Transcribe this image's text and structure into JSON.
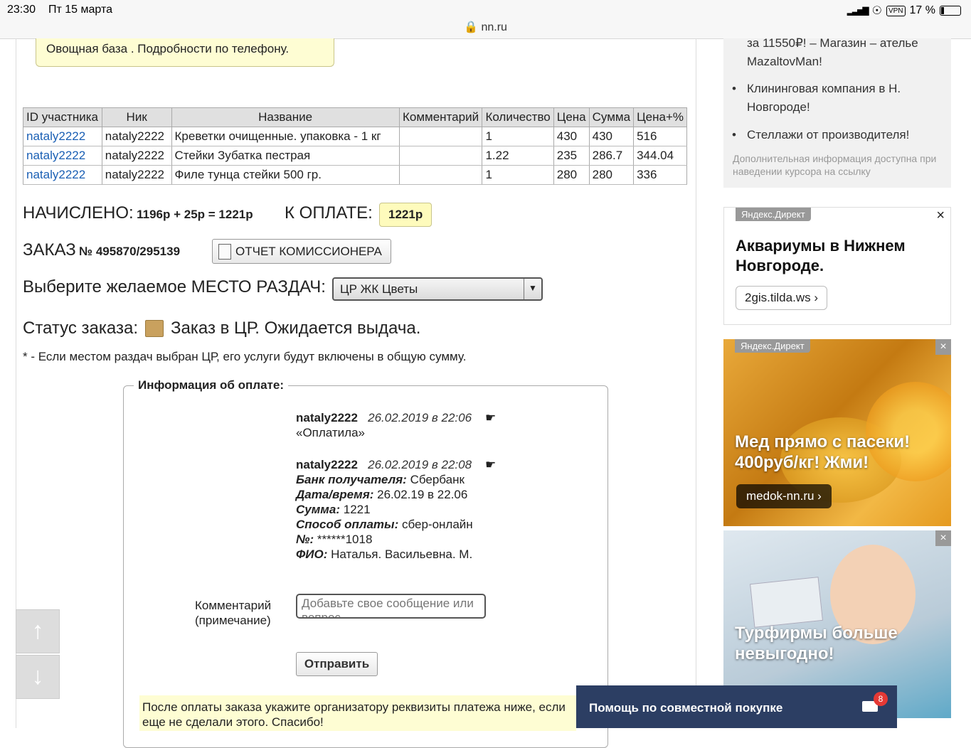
{
  "statusbar": {
    "time": "23:30",
    "date": "Пт 15 марта",
    "url": "nn.ru",
    "vpn": "VPN",
    "battery": "17 %"
  },
  "notice": {
    "text": "Овощная база . Подробности по телефону."
  },
  "orders": {
    "headers": [
      "ID участника",
      "Ник",
      "Название",
      "Комментарий",
      "Количество",
      "Цена",
      "Сумма",
      "Цена+%"
    ],
    "rows": [
      {
        "id": "nataly2222",
        "nick": "nataly2222",
        "name": "Креветки очищенные. упаковка - 1 кг",
        "comment": "",
        "qty": "1",
        "price": "430",
        "sum": "430",
        "price_pct": "516"
      },
      {
        "id": "nataly2222",
        "nick": "nataly2222",
        "name": "Стейки Зубатка пестрая",
        "comment": "",
        "qty": "1.22",
        "price": "235",
        "sum": "286.7",
        "price_pct": "344.04"
      },
      {
        "id": "nataly2222",
        "nick": "nataly2222",
        "name": "Филе тунца стейки 500 гр.",
        "comment": "",
        "qty": "1",
        "price": "280",
        "sum": "280",
        "price_pct": "336"
      }
    ]
  },
  "summary": {
    "charged_label": "НАЧИСЛЕНО:",
    "charged_value": "1196р + 25р = 1221р",
    "topay_label": "К ОПЛАТЕ:",
    "topay_value": "1221р",
    "order_label": "ЗАКАЗ",
    "order_number": "№ 495870/295139",
    "report_button": "ОТЧЕТ КОМИССИОНЕРА",
    "pickup_label": "Выберите желаемое МЕСТО РАЗДАЧ:",
    "pickup_selected": "ЦР ЖК Цветы",
    "status_label": "Статус заказа:",
    "status_value": "Заказ в ЦР. Ожидается выдача.",
    "footnote": "* - Если местом раздач выбран ЦР, его услуги будут включены в общую сумму."
  },
  "payment": {
    "legend": "Информация об оплате:",
    "entry1": {
      "user": "nataly2222",
      "datetime": "26.02.2019 в 22:06",
      "text": "«Оплатила»"
    },
    "entry2": {
      "user": "nataly2222",
      "datetime": "26.02.2019 в 22:08",
      "bank_label": "Банк получателя:",
      "bank": "Сбербанк",
      "date_label": "Дата/время:",
      "date": "26.02.19 в 22.06",
      "sum_label": "Сумма:",
      "sum": "1221",
      "method_label": "Способ оплаты:",
      "method": "сбер-онлайн",
      "num_label": "№:",
      "num": "******1018",
      "fio_label": "ФИО:",
      "fio": "Наталья. Васильевна. М."
    },
    "comment_label_1": "Комментарий",
    "comment_label_2": "(примечание)",
    "comment_placeholder": "Добавьте свое сообщение или вопрос",
    "send_button": "Отправить",
    "after_note": "После оплаты заказа укажите организатору реквизиты платежа ниже, если еще не сделали этого. Спасибо!"
  },
  "sidebar": {
    "top_text_1": "за 11550₽! – Магазин – ателье",
    "top_text_2": "MazaltovMan!",
    "items": [
      "Клининговая компания в Н. Новгороде!",
      "Стеллажи от производителя!"
    ],
    "hint": "Дополнительная информация доступна при наведении курсора на ссылку",
    "ad1": {
      "label": "Яндекс.Директ",
      "title": "Аквариумы в Нижнем Новгороде.",
      "link": "2gis.tilda.ws"
    },
    "ad2": {
      "label": "Яндекс.Директ",
      "title": "Мед прямо с пасеки! 400руб/кг! Жми!",
      "link": "medok-nn.ru"
    },
    "ad3": {
      "title": "Турфирмы больше невыгодно!"
    }
  },
  "helpbar": {
    "text": "Помощь по совместной покупке",
    "badge": "8"
  },
  "colors": {
    "link": "#1a5fb4",
    "paybox": "#fefbbc",
    "helpbar": "#2c3e63",
    "badge": "#e53935"
  }
}
